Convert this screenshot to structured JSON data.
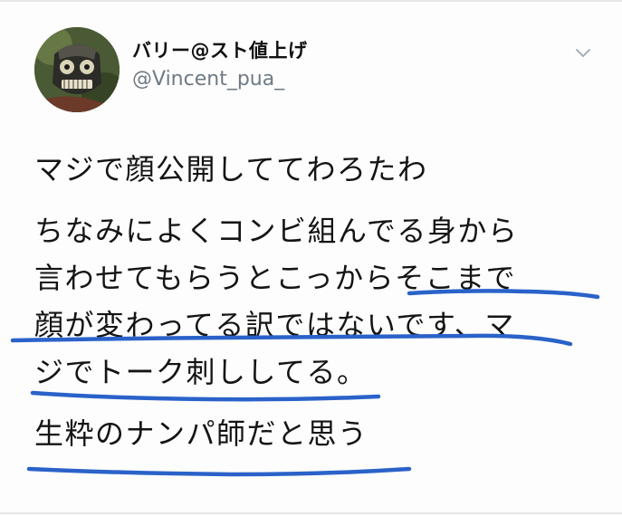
{
  "tweet": {
    "author": {
      "display_name": "バリー@スト値上げ",
      "handle": "@Vincent_pua_"
    },
    "menu_icon": "chevron-down-icon",
    "lines": [
      "マジで顔公開しててわろたわ",
      "ちなみによくコンビ組んでる身から",
      "言わせてもらうとこっからそこまで",
      "顔が変わってる訳ではないです、マ",
      "ジでトーク刺ししてる。",
      "生粋のナンパ師だと思う"
    ],
    "annotation_color": "#2a62c9"
  }
}
